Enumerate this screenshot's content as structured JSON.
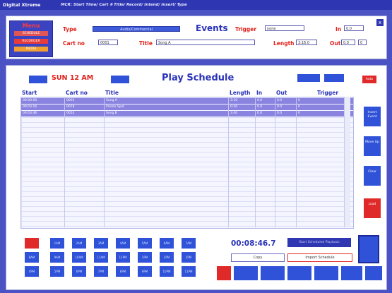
{
  "app": {
    "title": "Digital Xtreme",
    "hint": "MCR: Start Time/ Cart # Title/ Record/ Intend/ Insert/ Type"
  },
  "menu": {
    "title": "Menu",
    "items": [
      "SCHEDULE",
      "RECORDER",
      "MEDIA"
    ]
  },
  "events": {
    "title": "Events",
    "type_label": "Type",
    "type_value": "Audio/Commercial",
    "cart_label": "Cart no",
    "cart_value": "0001",
    "title_label": "Title",
    "title_value": "Song A",
    "trigger_label": "Trigger",
    "trigger_value": "none",
    "in_label": "In",
    "in_value": "0.0",
    "length_label": "Length",
    "length_value": "3:16.0",
    "out_label": "Out",
    "out_value": "0.0",
    "out_extra": "0",
    "close_label": "x"
  },
  "schedule": {
    "date_label": "SUN 12 AM",
    "title": "Play Schedule",
    "auto_label": "Auto",
    "columns": [
      "Start",
      "Cart no",
      "Title",
      "Length",
      "In",
      "Out",
      "Trigger"
    ],
    "rows": [
      {
        "start": "00:00:00",
        "cart": "0001",
        "title": "Song A",
        "length": "3:16",
        "in": "0.0",
        "out": "0.0",
        "trigger": "0"
      },
      {
        "start": "00:03:16",
        "cart": "0078",
        "title": "Promo Spot",
        "length": "0:30",
        "in": "0.0",
        "out": "0.0",
        "trigger": "0"
      },
      {
        "start": "00:03:46",
        "cart": "0052",
        "title": "Song B",
        "length": "3:40",
        "in": "0.0",
        "out": "0.0",
        "trigger": "0"
      }
    ],
    "side_buttons": [
      "Insert Event",
      "Move Up",
      "Clear",
      "Load"
    ],
    "hour_buttons_row1": [
      "",
      "1AM",
      "2AM",
      "3AM",
      "4AM",
      "5AM",
      "6AM",
      "7AM"
    ],
    "hour_buttons_row2": [
      "8AM",
      "9AM",
      "10AM",
      "11AM",
      "12PM",
      "1PM",
      "2PM",
      "3PM"
    ],
    "hour_buttons_row3": [
      "4PM",
      "5PM",
      "6PM",
      "7PM",
      "8PM",
      "9PM",
      "10PM",
      "11PM"
    ],
    "time_display": "00:08:46.7",
    "status_label": "Start Scheduled Playback",
    "copy_label": "Copy",
    "import_label": "Import Schedule"
  },
  "colors": {
    "background": "#4a52c4",
    "accent_blue": "#2f52d8",
    "accent_red": "#e02a2a",
    "title_blue": "#2a33b8",
    "row_highlight": "#8a83e0"
  }
}
